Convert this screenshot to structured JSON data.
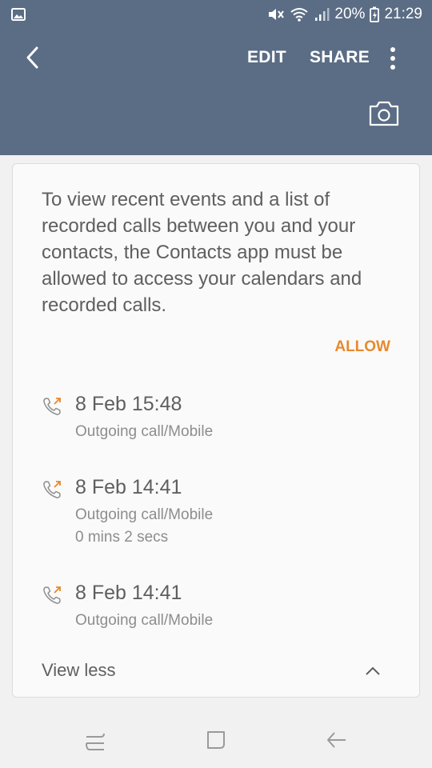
{
  "status_bar": {
    "battery": "20%",
    "time": "21:29"
  },
  "toolbar": {
    "edit_label": "EDIT",
    "share_label": "SHARE"
  },
  "card": {
    "permission_message": "To view recent events and a list of recorded calls between you and your contacts, the Contacts app must be allowed to access your calendars and recorded calls.",
    "allow_label": "ALLOW",
    "calls": [
      {
        "date": "8 Feb 15:48",
        "type": "Outgoing call/Mobile",
        "duration": ""
      },
      {
        "date": "8 Feb 14:41",
        "type": "Outgoing call/Mobile",
        "duration": "0 mins 2 secs"
      },
      {
        "date": "8 Feb 14:41",
        "type": "Outgoing call/Mobile",
        "duration": ""
      }
    ],
    "view_less_label": "View less"
  },
  "colors": {
    "app_bar": "#5b6d85",
    "accent": "#e8892c"
  }
}
